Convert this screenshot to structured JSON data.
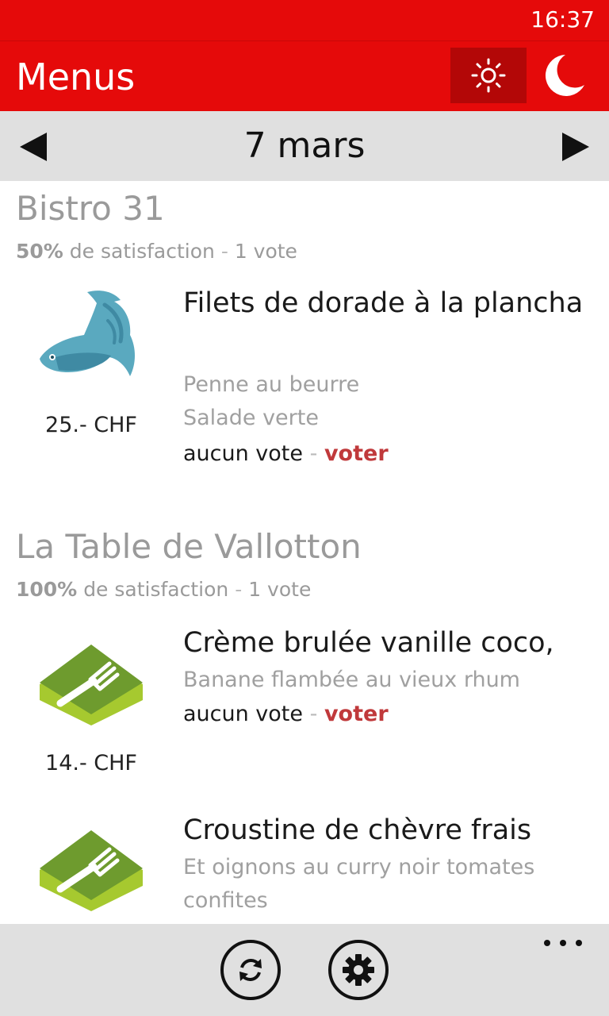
{
  "status": {
    "time": "16:37"
  },
  "appbar": {
    "title": "Menus",
    "sun_icon": "sun-icon",
    "moon_icon": "moon-icon"
  },
  "datebar": {
    "date": "7 mars",
    "prev_icon": "triangle-left-icon",
    "next_icon": "triangle-right-icon"
  },
  "restaurants": [
    {
      "name": "Bistro 31",
      "satisfaction_pct": "50%",
      "satisfaction_text": "de satisfaction",
      "separator": "-",
      "votes": "1 vote",
      "dishes": [
        {
          "icon": "fish-icon",
          "price": "25.- CHF",
          "title": "Filets de dorade à la plancha",
          "sides": [
            "Penne au beurre",
            "Salade verte"
          ],
          "vote_status": "aucun vote",
          "vote_action": "voter"
        }
      ]
    },
    {
      "name": "La Table de Vallotton",
      "satisfaction_pct": "100%",
      "satisfaction_text": "de satisfaction",
      "separator": "-",
      "votes": "1 vote",
      "dishes": [
        {
          "icon": "fork-plate-icon",
          "price": "14.- CHF",
          "title": "Crème brulée vanille coco,",
          "sides": [
            "Banane flambée au vieux rhum"
          ],
          "vote_status": "aucun vote",
          "vote_action": "voter"
        },
        {
          "icon": "fork-plate-icon",
          "title": "Croustine de chèvre frais",
          "sides": [
            "Et oignons au curry noir tomates confites"
          ]
        }
      ]
    }
  ],
  "bottombar": {
    "refresh_icon": "refresh-icon",
    "settings_icon": "gear-icon",
    "more_icon": "ellipsis-icon"
  },
  "colors": {
    "accent": "#e50a0a",
    "accent_dark": "#b30707",
    "vote_link": "#c0393b",
    "muted_text": "#9a9a9a",
    "bar_gray": "#e0e0e0"
  }
}
